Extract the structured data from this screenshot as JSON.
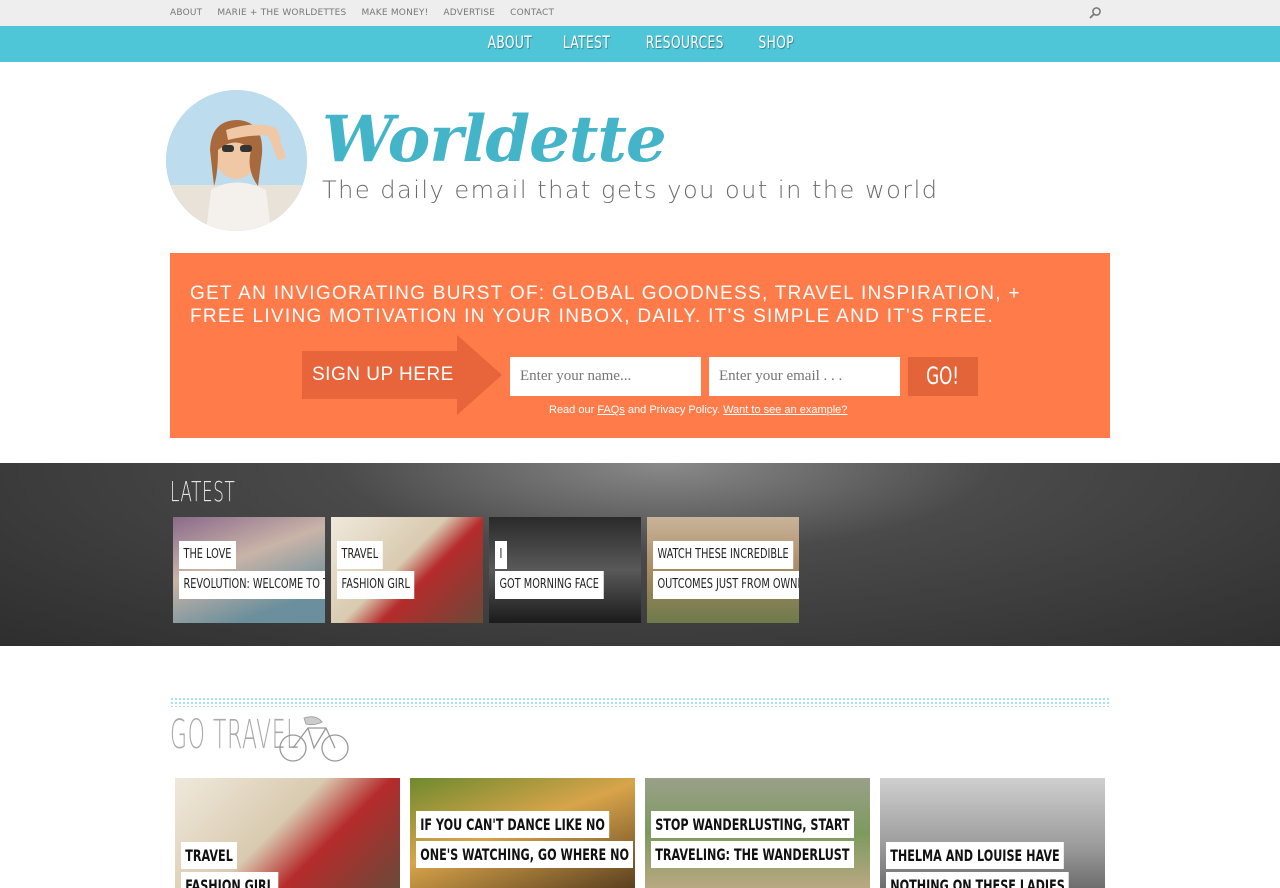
{
  "topbar": {
    "links": [
      "ABOUT",
      "MARIE + THE WORLDETTES",
      "MAKE MONEY!",
      "ADVERTISE",
      "CONTACT"
    ]
  },
  "navbar": {
    "items": [
      "ABOUT",
      "LATEST",
      "RESOURCES",
      "SHOP"
    ]
  },
  "header": {
    "brand": "Worldette",
    "tagline": "The daily email that gets you out in the world"
  },
  "signup": {
    "headline_line1": "GET AN INVIGORATING BURST OF: GLOBAL GOODNESS, TRAVEL INSPIRATION, +",
    "headline_line2": "FREE LIVING MOTIVATION IN YOUR INBOX, DAILY. IT'S SIMPLE AND IT'S FREE.",
    "arrow_label": "SIGN UP HERE",
    "name_placeholder": "Enter your name...",
    "email_placeholder": "Enter your email . . .",
    "go_label": "GO!",
    "note_prefix": "Read our",
    "faqs_link": "FAQs",
    "note_middle": "and Privacy Policy.",
    "example_link": "Want to see an example?"
  },
  "latest": {
    "title": "LATEST",
    "items": [
      {
        "line1": "THE LOVE",
        "line2": "REVOLUTION: WELCOME TO THE NEW"
      },
      {
        "line1": "TRAVEL",
        "line2": "FASHION GIRL"
      },
      {
        "line1": "I",
        "line2": "GOT MORNING FACE"
      },
      {
        "line1": "WATCH THESE INCREDIBLE",
        "line2": "OUTCOMES JUST FROM OWNING"
      }
    ]
  },
  "gotravel": {
    "title": "GO TRAVEL",
    "cards": [
      {
        "line1": "TRAVEL",
        "line2": "FASHION GIRL"
      },
      {
        "line1": "IF YOU CAN'T DANCE LIKE NO",
        "line2": "ONE'S WATCHING, GO WHERE NO"
      },
      {
        "line1": "STOP WANDERLUSTING, START",
        "line2": "TRAVELING: THE WANDERLUST"
      },
      {
        "line1": "THELMA AND LOUISE HAVE",
        "line2": "NOTHING ON THESE LADIES"
      }
    ]
  },
  "colors": {
    "nav": "#4fc6d8",
    "signup": "#ff7b4a",
    "brand": "#44b4c9"
  },
  "icons": [
    "search-icon",
    "bicycle-icon"
  ]
}
